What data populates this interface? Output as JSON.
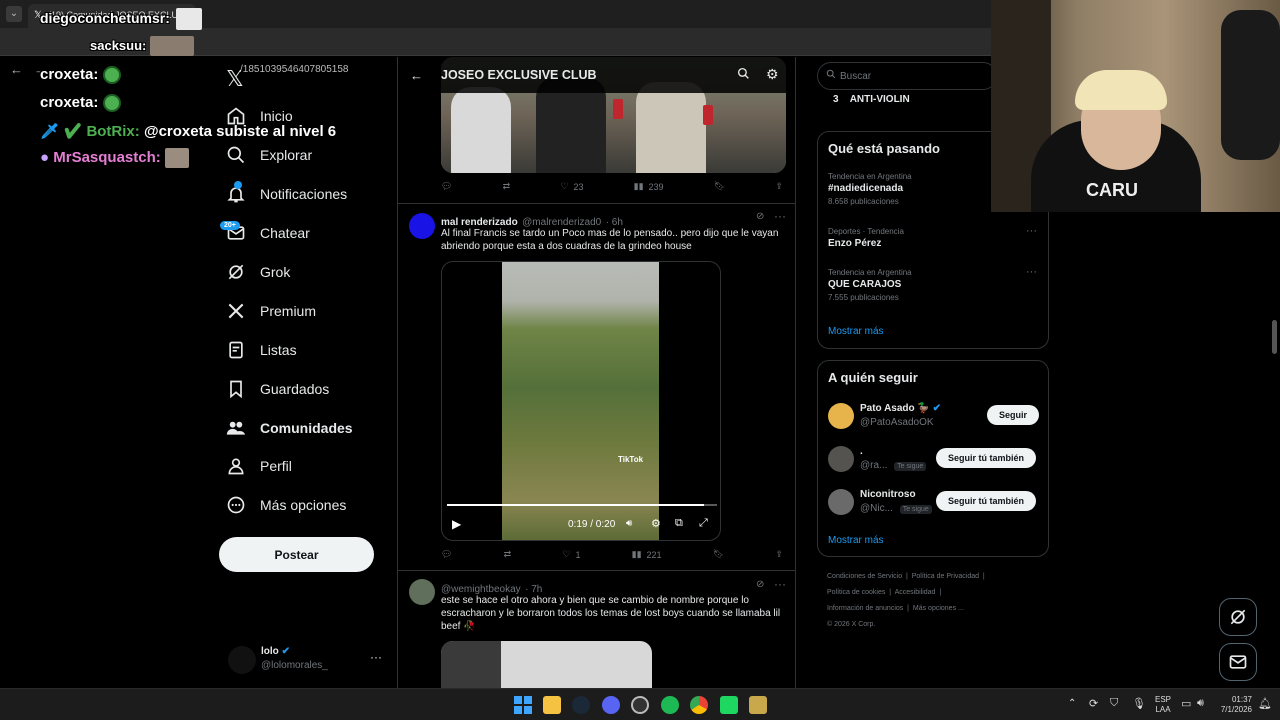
{
  "browser": {
    "tab_title": "(19) Comunidad JOSEO EXCLU",
    "url": "/1851039546407805158"
  },
  "overlay": {
    "top_name": "diegoconchetumsr:",
    "top_name_2": "sacksuu:",
    "chat": [
      {
        "user": "croxeta:",
        "msg": ""
      },
      {
        "user": "croxeta:",
        "msg": ""
      },
      {
        "user": "BotRix:",
        "msg": "@croxeta subiste al nivel 6"
      },
      {
        "user": "MrSasquastch:",
        "msg": ""
      }
    ]
  },
  "nav": {
    "items": [
      {
        "label": "Inicio",
        "icon": "home-icon"
      },
      {
        "label": "Explorar",
        "icon": "search-icon"
      },
      {
        "label": "Notificaciones",
        "icon": "bell-icon"
      },
      {
        "label": "Chatear",
        "icon": "mail-icon",
        "badge": "20+"
      },
      {
        "label": "Grok",
        "icon": "grok-icon"
      },
      {
        "label": "Premium",
        "icon": "x-icon"
      },
      {
        "label": "Listas",
        "icon": "list-icon"
      },
      {
        "label": "Guardados",
        "icon": "bookmark-icon"
      },
      {
        "label": "Comunidades",
        "icon": "people-icon"
      },
      {
        "label": "Perfil",
        "icon": "person-icon"
      },
      {
        "label": "Más opciones",
        "icon": "more-circle-icon"
      }
    ],
    "post_button": "Postear",
    "account": {
      "name": "lolo",
      "handle": "@lolomorales_"
    }
  },
  "community": {
    "title": "JOSEO EXCLUSIVE CLUB"
  },
  "tweets": [
    {
      "stats": {
        "replies": "",
        "retweets": "",
        "likes": "23",
        "views": "239"
      }
    },
    {
      "name": "mal renderizado",
      "handle": "@malrenderizad0",
      "time": "· 6h",
      "text": "Al final Francis se tardo un Poco mas de lo pensado.. pero dijo que le vayan abriendo porque esta a dos cuadras de la grindeo house",
      "video_time": "0:19 / 0:20",
      "progress": 0.95,
      "watermark": "TikTok",
      "stats": {
        "replies": "",
        "retweets": "",
        "likes": "1",
        "views": "221"
      }
    },
    {
      "name": "",
      "handle": "@wemightbeokay",
      "time": "· 7h",
      "text": "este se hace el otro ahora y bien que se cambio de nombre porque lo escracharon y le borraron todos los temas de lost boys cuando se llamaba lil beef 🥀"
    }
  ],
  "right": {
    "search_placeholder": "Buscar",
    "top_item": {
      "rank": "3",
      "label": "ANTI-VIOLIN"
    },
    "trends_title": "Qué está pasando",
    "trends": [
      {
        "meta": "Tendencia en Argentina",
        "name": "#nadiedicenada",
        "count": "8.658 publicaciones"
      },
      {
        "meta": "Deportes · Tendencia",
        "name": "Enzo Pérez",
        "count": ""
      },
      {
        "meta": "Tendencia en Argentina",
        "name": "QUE CARAJOS",
        "count": "7.555 publicaciones"
      }
    ],
    "show_more": "Mostrar más",
    "follow_title": "A quién seguir",
    "follow": [
      {
        "name": "Pato Asado 🦆",
        "handle": "@PatoAsadoOK",
        "follows_you": "",
        "button": "Seguir"
      },
      {
        "name": ".",
        "handle": "@ra...",
        "follows_you": "Te sigue",
        "button": "Seguir tú también"
      },
      {
        "name": "Niconitroso",
        "handle": "@Nic...",
        "follows_you": "Te sigue",
        "button": "Seguir tú también"
      }
    ],
    "show_more_2": "Mostrar más",
    "footer": [
      "Condiciones de Servicio",
      "Política de Privacidad",
      "Política de cookies",
      "Accesibilidad",
      "Información de anuncios",
      "Más opciones ...",
      "© 2026 X Corp."
    ]
  },
  "taskbar": {
    "lang": "ESP",
    "lang2": "LAA",
    "time": "01:37",
    "date": "7/1/2026"
  },
  "colors": {
    "accent": "#1d9bf0",
    "bg": "#000000",
    "border": "#2f3336",
    "muted": "#71767b"
  }
}
